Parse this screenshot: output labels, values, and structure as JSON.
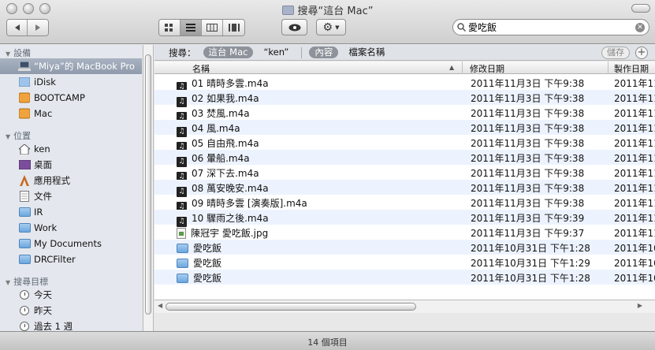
{
  "window": {
    "title": "搜尋“這台 Mac”"
  },
  "toolbar": {
    "back_icon": "back-arrow-icon",
    "forward_icon": "forward-arrow-icon",
    "view_modes": [
      "icon-view",
      "list-view",
      "column-view",
      "coverflow-view"
    ],
    "active_view": "list-view",
    "search_value": "愛吃飯"
  },
  "sidebar": {
    "devices_header": "設備",
    "devices": [
      {
        "label": "“Miya”的 MacBook Pro",
        "icon": "laptop-icon",
        "selected": true
      },
      {
        "label": "iDisk",
        "icon": "idisk-icon"
      },
      {
        "label": "BOOTCAMP",
        "icon": "drive-icon"
      },
      {
        "label": "Mac",
        "icon": "drive-icon"
      }
    ],
    "places_header": "位置",
    "places": [
      {
        "label": "ken",
        "icon": "home-icon"
      },
      {
        "label": "桌面",
        "icon": "desktop-icon"
      },
      {
        "label": "應用程式",
        "icon": "applications-icon"
      },
      {
        "label": "文件",
        "icon": "documents-icon"
      },
      {
        "label": "IR",
        "icon": "folder-icon"
      },
      {
        "label": "Work",
        "icon": "folder-icon"
      },
      {
        "label": "My Documents",
        "icon": "folder-icon"
      },
      {
        "label": "DRCFilter",
        "icon": "folder-icon"
      }
    ],
    "search_header": "搜尋目標",
    "searches": [
      {
        "label": "今天",
        "icon": "clock-icon"
      },
      {
        "label": "昨天",
        "icon": "clock-icon"
      },
      {
        "label": "過去 1 週",
        "icon": "clock-icon"
      }
    ]
  },
  "scopebar": {
    "label": "搜尋：",
    "this_mac": "這台 Mac",
    "ken": "“ken”",
    "contents": "內容",
    "filename": "檔案名稱",
    "save": "儲存",
    "add": "+"
  },
  "columns": {
    "name": "名稱",
    "modified": "修改日期",
    "created": "製作日期"
  },
  "files": [
    {
      "name": "01 晴時多雲.m4a",
      "modified": "2011年11月3日 下午9:38",
      "created": "2011年11",
      "kind": "music"
    },
    {
      "name": "02 如果我.m4a",
      "modified": "2011年11月3日 下午9:38",
      "created": "2011年11",
      "kind": "music"
    },
    {
      "name": "03 焚風.m4a",
      "modified": "2011年11月3日 下午9:38",
      "created": "2011年11",
      "kind": "music"
    },
    {
      "name": "04 風.m4a",
      "modified": "2011年11月3日 下午9:38",
      "created": "2011年11",
      "kind": "music"
    },
    {
      "name": "05 自由飛.m4a",
      "modified": "2011年11月3日 下午9:38",
      "created": "2011年11",
      "kind": "music"
    },
    {
      "name": "06 暈船.m4a",
      "modified": "2011年11月3日 下午9:38",
      "created": "2011年11",
      "kind": "music"
    },
    {
      "name": "07 深下去.m4a",
      "modified": "2011年11月3日 下午9:38",
      "created": "2011年11",
      "kind": "music"
    },
    {
      "name": "08 萬安晚安.m4a",
      "modified": "2011年11月3日 下午9:38",
      "created": "2011年11",
      "kind": "music"
    },
    {
      "name": "09 晴時多雲 [演奏版].m4a",
      "modified": "2011年11月3日 下午9:38",
      "created": "2011年11",
      "kind": "music"
    },
    {
      "name": "10 驟雨之後.m4a",
      "modified": "2011年11月3日 下午9:39",
      "created": "2011年11",
      "kind": "music"
    },
    {
      "name": "陳冠宇 愛吃飯.jpg",
      "modified": "2011年11月3日 下午9:37",
      "created": "2011年11",
      "kind": "image"
    },
    {
      "name": "愛吃飯",
      "modified": "2011年10月31日 下午1:28",
      "created": "2011年10",
      "kind": "folder"
    },
    {
      "name": "愛吃飯",
      "modified": "2011年10月31日 下午1:29",
      "created": "2011年10",
      "kind": "folder"
    },
    {
      "name": "愛吃飯",
      "modified": "2011年10月31日 下午1:28",
      "created": "2011年10",
      "kind": "folder"
    }
  ],
  "status": {
    "count_text": "14 個項目"
  }
}
